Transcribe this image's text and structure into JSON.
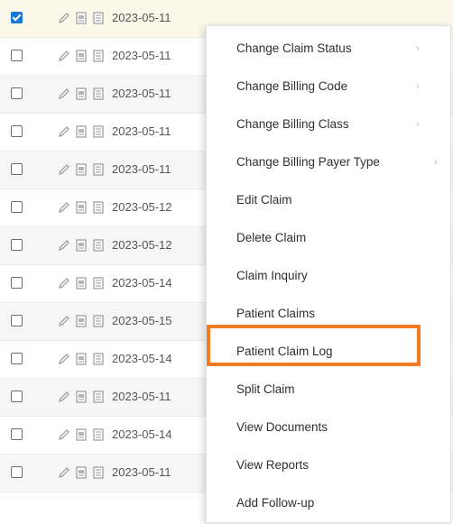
{
  "table": {
    "rows": [
      {
        "date": "2023-05-11",
        "checked": true
      },
      {
        "date": "2023-05-11",
        "checked": false
      },
      {
        "date": "2023-05-11",
        "checked": false
      },
      {
        "date": "2023-05-11",
        "checked": false
      },
      {
        "date": "2023-05-11",
        "checked": false
      },
      {
        "date": "2023-05-12",
        "checked": false
      },
      {
        "date": "2023-05-12",
        "checked": false
      },
      {
        "date": "2023-05-14",
        "checked": false
      },
      {
        "date": "2023-05-15",
        "checked": false
      },
      {
        "date": "2023-05-14",
        "checked": false
      },
      {
        "date": "2023-05-11",
        "checked": false
      }
    ]
  },
  "menu": {
    "items": [
      {
        "label": "Change Claim Status",
        "has_submenu": true
      },
      {
        "label": "Change Billing Code",
        "has_submenu": true
      },
      {
        "label": "Change Billing Class",
        "has_submenu": true
      },
      {
        "label": "Change Billing Payer Type",
        "has_submenu": true
      },
      {
        "label": "Edit Claim",
        "has_submenu": false
      },
      {
        "label": "Delete Claim",
        "has_submenu": false
      },
      {
        "label": "Claim Inquiry",
        "has_submenu": false
      },
      {
        "label": "Patient Claims",
        "has_submenu": false
      },
      {
        "label": "Patient Claim Log",
        "has_submenu": false
      },
      {
        "label": "Split Claim",
        "has_submenu": false
      },
      {
        "label": "View Documents",
        "has_submenu": false
      },
      {
        "label": "View Reports",
        "has_submenu": false
      },
      {
        "label": "Add Follow-up",
        "has_submenu": false
      }
    ],
    "arrow_glyph": "›",
    "highlighted_item": "Patient Claim Log"
  },
  "colors": {
    "highlight_border": "#f07b24",
    "checkbox_checked": "#1976d2"
  },
  "icons": [
    "pencil-icon",
    "document-icon",
    "list-document-icon"
  ]
}
